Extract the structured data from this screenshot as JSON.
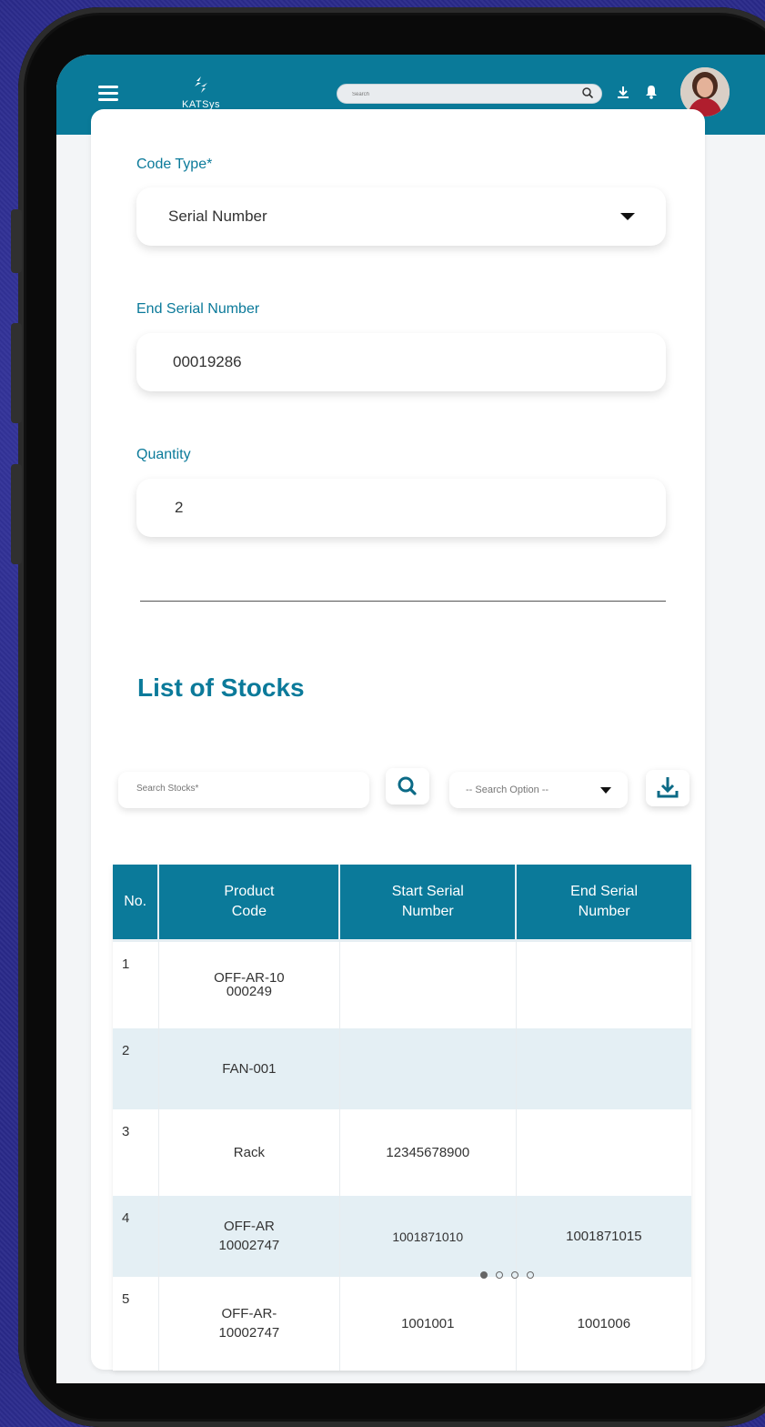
{
  "app": {
    "logo_text": "KATSys"
  },
  "header": {
    "search_placeholder": "Search",
    "icons": [
      "menu-icon",
      "download-icon",
      "bell-icon",
      "avatar"
    ]
  },
  "form": {
    "code_type": {
      "label": "Code Type*",
      "value": "Serial Number"
    },
    "end_serial": {
      "label": "End Serial Number",
      "value": "00019286"
    },
    "quantity": {
      "label": "Quantity",
      "value": "2"
    }
  },
  "stocks": {
    "title": "List of Stocks",
    "search_placeholder": "Search Stocks*",
    "search_option": "-- Search Option --",
    "columns": [
      "No.",
      "Product Code",
      "Start Serial Number",
      "End Serial Number"
    ],
    "rows": [
      {
        "no": "1",
        "product_code": "OFF-AR-10000249",
        "start_serial": "",
        "end_serial": ""
      },
      {
        "no": "2",
        "product_code": "FAN-001",
        "start_serial": "",
        "end_serial": ""
      },
      {
        "no": "3",
        "product_code": "Rack",
        "start_serial": "12345678900",
        "end_serial": ""
      },
      {
        "no": "4",
        "product_code": "OFF-AR 10002747",
        "start_serial": "1001871010",
        "end_serial": "1001871015"
      },
      {
        "no": "5",
        "product_code": "OFF-AR-10002747",
        "start_serial": "1001001",
        "end_serial": "1001006"
      }
    ],
    "pagination": {
      "pages": 4,
      "current": 1
    }
  },
  "colors": {
    "primary": "#0b7a9a",
    "row_alt": "#e4eff4",
    "background": "#2a2a8a"
  }
}
